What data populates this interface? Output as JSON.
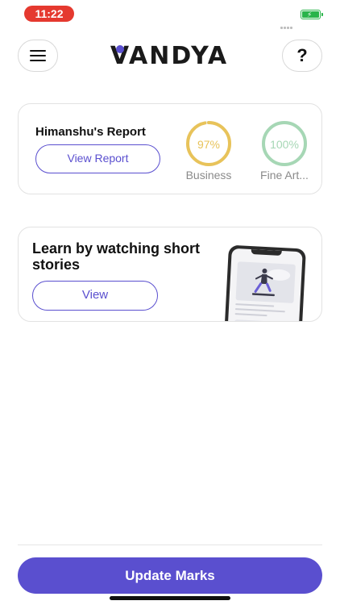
{
  "status_bar": {
    "time": "11:22",
    "time_color": "#e5392f",
    "battery_color": "#29b44a"
  },
  "header": {
    "logo_text": "VANDYA",
    "menu_icon": "hamburger-icon",
    "help_label": "?"
  },
  "report_card": {
    "title": "Himanshu's Report",
    "button_label": "View Report",
    "subjects": [
      {
        "label": "Business",
        "value_text": "97%",
        "progress": 0.97,
        "color": "#e8c35a"
      },
      {
        "label": "Fine Art...",
        "value_text": "100%",
        "progress": 1.0,
        "color": "#a6d7b5"
      }
    ]
  },
  "story_card": {
    "title": "Learn by watching short stories",
    "button_label": "View"
  },
  "footer": {
    "primary_label": "Update Marks"
  },
  "colors": {
    "accent": "#5a4fcf"
  }
}
